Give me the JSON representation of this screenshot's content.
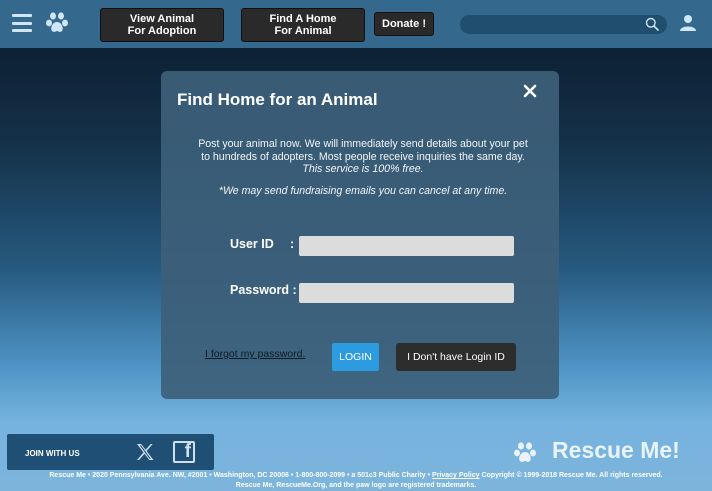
{
  "header": {
    "nav": {
      "view_adoption_line1": "View Animal",
      "view_adoption_line2": "For Adoption",
      "find_home_line1": "Find A Home",
      "find_home_line2": "For Animal",
      "donate": "Donate !"
    },
    "search": {
      "placeholder": "",
      "value": ""
    }
  },
  "modal": {
    "title": "Find Home for an Animal",
    "intro_line1": "Post your animal now. We will immediately send details about your pet",
    "intro_line2": "to hundreds of adopters. Most people receive inquiries the same day.",
    "intro_line3": "This service is 100% free.",
    "fundraising_note": "*We may send fundraising emails you can cancel at any time.",
    "user_id_label": "User ID",
    "user_id_colon": ":",
    "password_label": "Password :",
    "user_id_value": "",
    "password_value": "",
    "forgot_link": "I forgot my password.",
    "login_button": "LOGIN",
    "no_login_button": "I Don't have Login ID"
  },
  "footer": {
    "join_label": "JOIN WITH US",
    "brand": "Rescue Me!",
    "legal_part1": "Rescue Me • 2020 Pennsylvania Ave. NW, #2001 • Washington, DC 20006 • 1-800-800-2099 • a 501c3 Public Charity • ",
    "privacy_link": "Privacy Policy",
    "legal_part2": " Copyright © 1999-2018 Rescue Me. All rights reserved.",
    "legal_line2": "Rescue Me, RescueMe.Org, and the paw logo are registered trademarks."
  },
  "colors": {
    "topbar": "#35688d",
    "nav_button": "#2a2a2a",
    "modal": "#3d607a",
    "login_accent": "#2d9be0",
    "footer_panel": "#1f4f74"
  },
  "icons": [
    "menu-icon",
    "paw-logo-icon",
    "search-icon",
    "user-icon",
    "close-icon",
    "x-icon",
    "facebook-icon"
  ]
}
